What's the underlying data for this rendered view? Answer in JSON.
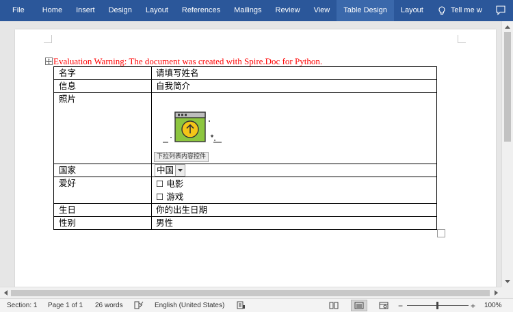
{
  "ribbon": {
    "tabs": [
      {
        "label": "File"
      },
      {
        "label": "Home"
      },
      {
        "label": "Insert"
      },
      {
        "label": "Design"
      },
      {
        "label": "Layout"
      },
      {
        "label": "References"
      },
      {
        "label": "Mailings"
      },
      {
        "label": "Review"
      },
      {
        "label": "View"
      },
      {
        "label": "Table Design",
        "active": true
      },
      {
        "label": "Layout"
      }
    ],
    "tell_me": "Tell me w",
    "colors": {
      "ribbon_bg": "#2b579a",
      "active_tab_bg": "#3a68ab"
    }
  },
  "document": {
    "warning": "Evaluation Warning: The document was created with Spire.Doc for Python.",
    "warning_color": "#ff0000",
    "table": {
      "rows": [
        {
          "label": "名字",
          "value": "请填写姓名"
        },
        {
          "label": "信息",
          "value": "自我简介"
        },
        {
          "label": "照片",
          "content_control_label": "下拉列表内容控件"
        },
        {
          "label": "国家",
          "dropdown_value": "中国"
        },
        {
          "label": "爱好",
          "checkboxes": [
            {
              "box": "☐",
              "text": "电影"
            },
            {
              "box": "☐",
              "text": "游戏"
            }
          ]
        },
        {
          "label": "生日",
          "value": "你的出生日期"
        },
        {
          "label": "性别",
          "value": "男性"
        }
      ]
    }
  },
  "status_bar": {
    "section": "Section: 1",
    "page": "Page 1 of 1",
    "words": "26 words",
    "language": "English (United States)",
    "zoom_minus": "−",
    "zoom_plus": "+",
    "zoom": "100%",
    "zoom_level_percent": 100
  }
}
